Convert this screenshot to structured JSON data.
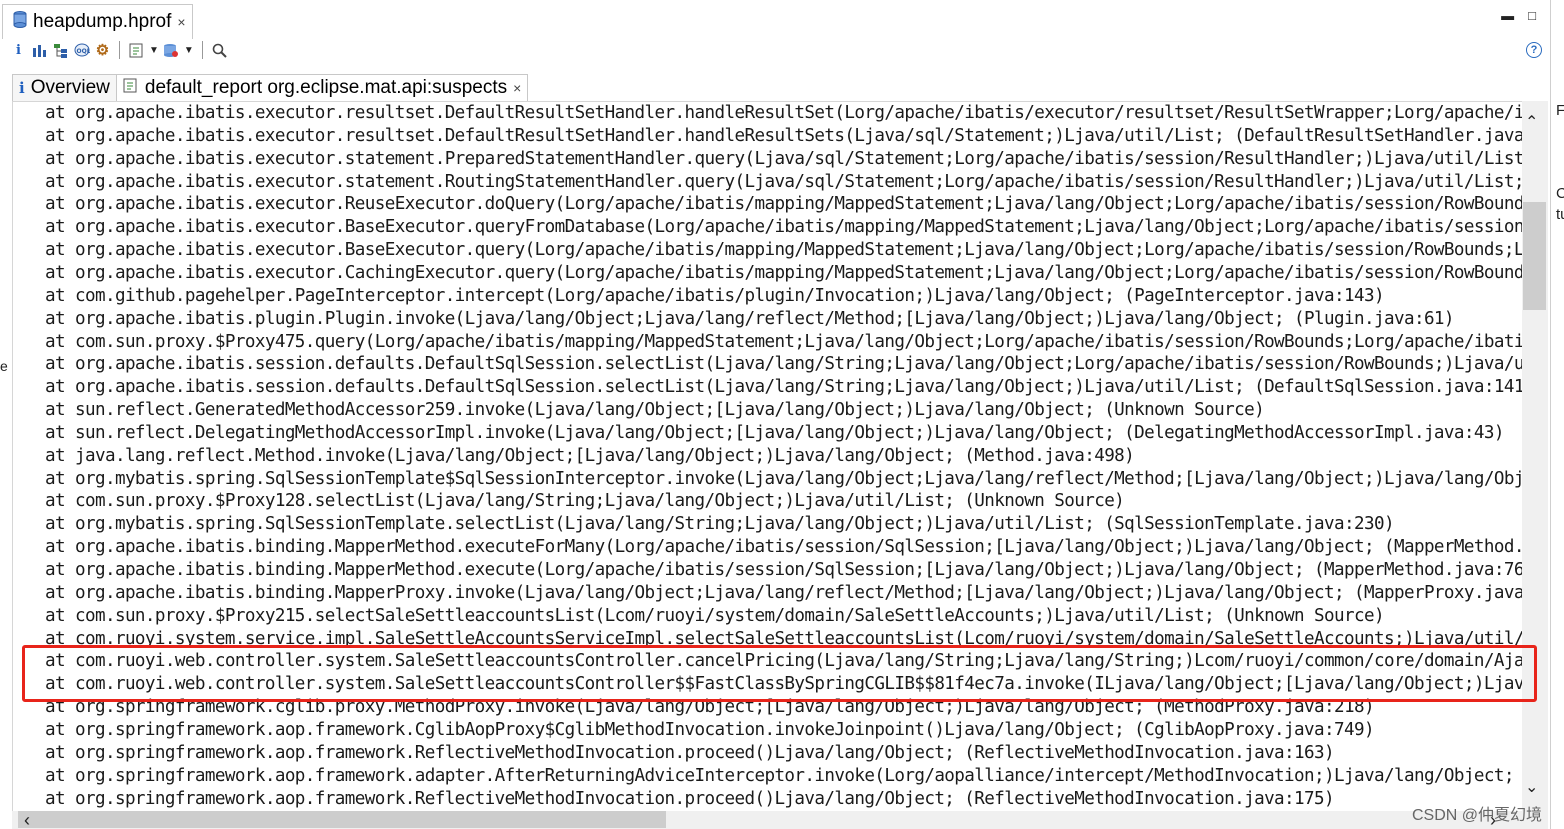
{
  "editor_tab": {
    "title": "heapdump.hprof",
    "close": "×"
  },
  "subtabs": [
    {
      "label": "Overview"
    },
    {
      "label": "default_report  org.eclipse.mat.api:suspects",
      "close": "×"
    }
  ],
  "toolbar": {
    "help_label": "?"
  },
  "stack_lines": [
    "at org.apache.ibatis.executor.resultset.DefaultResultSetHandler.handleResultSet(Lorg/apache/ibatis/executor/resultset/ResultSetWrapper;Lorg/apache/i",
    "at org.apache.ibatis.executor.resultset.DefaultResultSetHandler.handleResultSets(Ljava/sql/Statement;)Ljava/util/List; (DefaultResultSetHandler.java",
    "at org.apache.ibatis.executor.statement.PreparedStatementHandler.query(Ljava/sql/Statement;Lorg/apache/ibatis/session/ResultHandler;)Ljava/util/List",
    "at org.apache.ibatis.executor.statement.RoutingStatementHandler.query(Ljava/sql/Statement;Lorg/apache/ibatis/session/ResultHandler;)Ljava/util/List;",
    "at org.apache.ibatis.executor.ReuseExecutor.doQuery(Lorg/apache/ibatis/mapping/MappedStatement;Ljava/lang/Object;Lorg/apache/ibatis/session/RowBound",
    "at org.apache.ibatis.executor.BaseExecutor.queryFromDatabase(Lorg/apache/ibatis/mapping/MappedStatement;Ljava/lang/Object;Lorg/apache/ibatis/session",
    "at org.apache.ibatis.executor.BaseExecutor.query(Lorg/apache/ibatis/mapping/MappedStatement;Ljava/lang/Object;Lorg/apache/ibatis/session/RowBounds;L",
    "at org.apache.ibatis.executor.CachingExecutor.query(Lorg/apache/ibatis/mapping/MappedStatement;Ljava/lang/Object;Lorg/apache/ibatis/session/RowBound",
    "at com.github.pagehelper.PageInterceptor.intercept(Lorg/apache/ibatis/plugin/Invocation;)Ljava/lang/Object; (PageInterceptor.java:143)",
    "at org.apache.ibatis.plugin.Plugin.invoke(Ljava/lang/Object;Ljava/lang/reflect/Method;[Ljava/lang/Object;)Ljava/lang/Object; (Plugin.java:61)",
    "at com.sun.proxy.$Proxy475.query(Lorg/apache/ibatis/mapping/MappedStatement;Ljava/lang/Object;Lorg/apache/ibatis/session/RowBounds;Lorg/apache/ibati",
    "at org.apache.ibatis.session.defaults.DefaultSqlSession.selectList(Ljava/lang/String;Ljava/lang/Object;Lorg/apache/ibatis/session/RowBounds;)Ljava/u",
    "at org.apache.ibatis.session.defaults.DefaultSqlSession.selectList(Ljava/lang/String;Ljava/lang/Object;)Ljava/util/List; (DefaultSqlSession.java:141",
    "at sun.reflect.GeneratedMethodAccessor259.invoke(Ljava/lang/Object;[Ljava/lang/Object;)Ljava/lang/Object; (Unknown Source)",
    "at sun.reflect.DelegatingMethodAccessorImpl.invoke(Ljava/lang/Object;[Ljava/lang/Object;)Ljava/lang/Object; (DelegatingMethodAccessorImpl.java:43)",
    "at java.lang.reflect.Method.invoke(Ljava/lang/Object;[Ljava/lang/Object;)Ljava/lang/Object; (Method.java:498)",
    "at org.mybatis.spring.SqlSessionTemplate$SqlSessionInterceptor.invoke(Ljava/lang/Object;Ljava/lang/reflect/Method;[Ljava/lang/Object;)Ljava/lang/Obj",
    "at com.sun.proxy.$Proxy128.selectList(Ljava/lang/String;Ljava/lang/Object;)Ljava/util/List; (Unknown Source)",
    "at org.mybatis.spring.SqlSessionTemplate.selectList(Ljava/lang/String;Ljava/lang/Object;)Ljava/util/List; (SqlSessionTemplate.java:230)",
    "at org.apache.ibatis.binding.MapperMethod.executeForMany(Lorg/apache/ibatis/session/SqlSession;[Ljava/lang/Object;)Ljava/lang/Object; (MapperMethod.",
    "at org.apache.ibatis.binding.MapperMethod.execute(Lorg/apache/ibatis/session/SqlSession;[Ljava/lang/Object;)Ljava/lang/Object; (MapperMethod.java:76",
    "at org.apache.ibatis.binding.MapperProxy.invoke(Ljava/lang/Object;Ljava/lang/reflect/Method;[Ljava/lang/Object;)Ljava/lang/Object; (MapperProxy.java",
    "at com.sun.proxy.$Proxy215.selectSaleSettleaccountsList(Lcom/ruoyi/system/domain/SaleSettleAccounts;)Ljava/util/List; (Unknown Source)",
    "at com.ruoyi.system.service.impl.SaleSettleAccountsServiceImpl.selectSaleSettleaccountsList(Lcom/ruoyi/system/domain/SaleSettleAccounts;)Ljava/util/",
    "at com.ruoyi.web.controller.system.SaleSettleaccountsController.cancelPricing(Ljava/lang/String;Ljava/lang/String;)Lcom/ruoyi/common/core/domain/Aja",
    "at com.ruoyi.web.controller.system.SaleSettleaccountsController$$FastClassBySpringCGLIB$$81f4ec7a.invoke(ILjava/lang/Object;[Ljava/lang/Object;)Ljav",
    "at org.springframework.cglib.proxy.MethodProxy.invoke(Ljava/lang/Object;[Ljava/lang/Object;)Ljava/lang/Object; (MethodProxy.java:218)",
    "at org.springframework.aop.framework.CglibAopProxy$CglibMethodInvocation.invokeJoinpoint()Ljava/lang/Object; (CglibAopProxy.java:749)",
    "at org.springframework.aop.framework.ReflectiveMethodInvocation.proceed()Ljava/lang/Object; (ReflectiveMethodInvocation.java:163)",
    "at org.springframework.aop.framework.adapter.AfterReturningAdviceInterceptor.invoke(Lorg/aopalliance/intercept/MethodInvocation;)Ljava/lang/Object;",
    "at org.springframework.aop.framework.ReflectiveMethodInvocation.proceed()Ljava/lang/Object; (ReflectiveMethodInvocation.java:175)"
  ],
  "highlight_color": "#e8241a",
  "watermark": "CSDN @仲夏幻境",
  "edge_fragments": {
    "right": [
      "F",
      "C",
      "tu"
    ],
    "left": "e"
  },
  "icons": {
    "file": "database-file-icon",
    "info": "info-icon",
    "histogram": "histogram-icon",
    "dominator": "dominator-tree-icon",
    "oql": "oql-icon",
    "settings": "gear-icon",
    "run_report": "run-report-icon",
    "query_browser": "query-browser-icon",
    "search": "search-icon",
    "help": "help-icon"
  }
}
